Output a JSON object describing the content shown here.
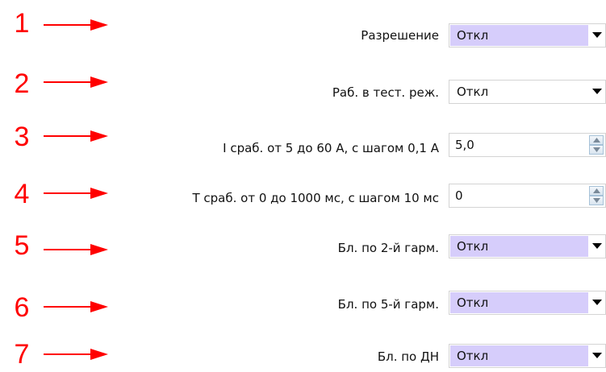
{
  "rows": [
    {
      "num": "1",
      "label": "Разрешение",
      "value": "Откл",
      "icon": "chevron-down-icon"
    },
    {
      "num": "2",
      "label": "Раб. в тест. реж.",
      "value": "Откл",
      "icon": "chevron-down-icon"
    },
    {
      "num": "3",
      "label": "I сраб. от 5 до 60 А, с шагом 0,1 А",
      "value": "5,0",
      "icon": "spin-arrows-icon"
    },
    {
      "num": "4",
      "label": "T сраб. от 0 до 1000 мс, с шагом 10 мс",
      "value": "0",
      "icon": "spin-arrows-icon"
    },
    {
      "num": "5",
      "label": "Бл. по 2-й гарм.",
      "value": "Откл",
      "icon": "chevron-down-icon"
    },
    {
      "num": "6",
      "label": "Бл. по 5-й гарм.",
      "value": "Откл",
      "icon": "chevron-down-icon"
    },
    {
      "num": "7",
      "label": "Бл. по ДН",
      "value": "Откл",
      "icon": "chevron-down-icon"
    }
  ],
  "colors": {
    "annotation": "#ff0000",
    "combo_highlight": "#d6cdfb",
    "border": "#d4d4d4"
  }
}
